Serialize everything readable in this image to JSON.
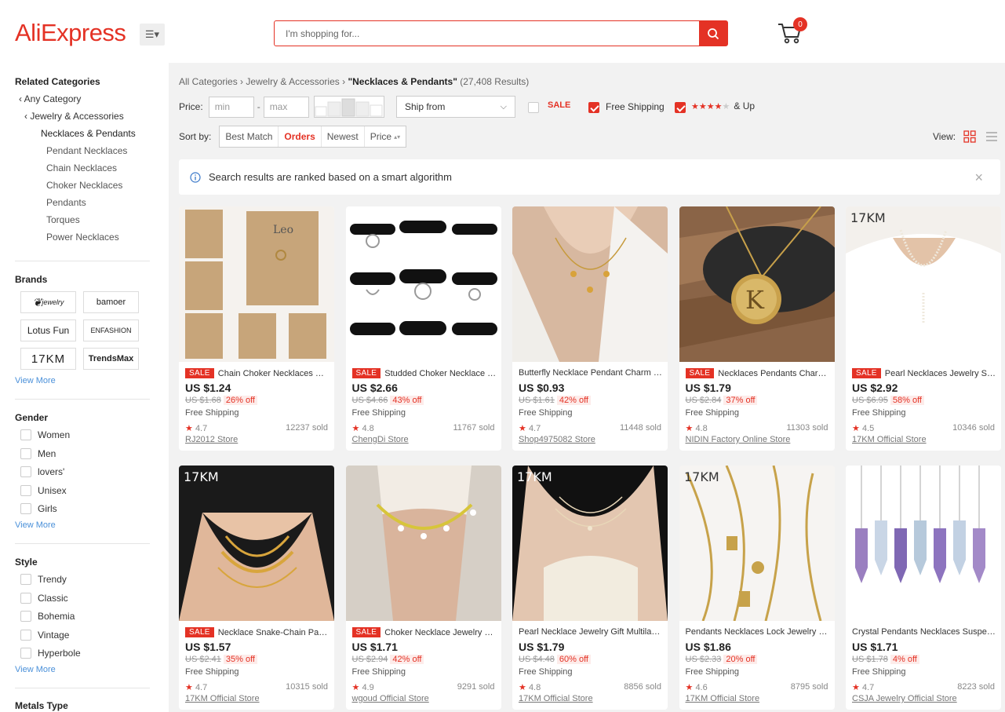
{
  "header": {
    "logo": "AliExpress",
    "menu_icon": "menu-icon",
    "search_placeholder": "I'm shopping for...",
    "cart_count": "0"
  },
  "sidebar": {
    "related_title": "Related Categories",
    "any_category": "Any Category",
    "jewelry_accessories": "Jewelry & Accessories",
    "current_category": "Necklaces & Pendants",
    "subcategories": [
      "Pendant Necklaces",
      "Chain Necklaces",
      "Choker Necklaces",
      "Pendants",
      "Torques",
      "Power Necklaces"
    ],
    "brands_title": "Brands",
    "brands": [
      "jewelry",
      "bamoer",
      "Lotus Fun",
      "ENFASHION",
      "17KM",
      "TrendsMax"
    ],
    "view_more": "View More",
    "gender_title": "Gender",
    "gender": [
      "Women",
      "Men",
      "lovers'",
      "Unisex",
      "Girls"
    ],
    "style_title": "Style",
    "style": [
      "Trendy",
      "Classic",
      "Bohemia",
      "Vintage",
      "Hyperbole"
    ],
    "metals_title": "Metals Type"
  },
  "main": {
    "breadcrumb": {
      "all": "All Categories",
      "parent": "Jewelry & Accessories",
      "current": "\"Necklaces & Pendants\"",
      "results": "(27,408 Results)"
    },
    "filters": {
      "price_label": "Price:",
      "min_placeholder": "min",
      "dash": "-",
      "max_placeholder": "max",
      "ship_from": "Ship from",
      "sale": "SALE",
      "free_shipping": "Free Shipping",
      "stars_up": "& Up"
    },
    "sort": {
      "label": "Sort by:",
      "options": [
        "Best Match",
        "Orders",
        "Newest",
        "Price"
      ],
      "active": "Orders",
      "view_label": "View:"
    },
    "notice": "Search results are ranked based on a smart algorithm"
  },
  "colors": {
    "accent": "#e43225",
    "background": "#f2f2f2"
  },
  "products": [
    {
      "sale": true,
      "title": "Chain Choker Necklaces Pendants Women",
      "price": "US $1.24",
      "orig": "US $1.68",
      "off": "26% off",
      "shipping": "Free Shipping",
      "rating": "4.7",
      "sold": "12237 sold",
      "store": "RJ2012 Store"
    },
    {
      "sale": true,
      "title": "Studded Choker Necklace Punk Leather",
      "price": "US $2.66",
      "orig": "US $4.66",
      "off": "43% off",
      "shipping": "Free Shipping",
      "rating": "4.8",
      "sold": "11767 sold",
      "store": "ChengDi Store"
    },
    {
      "sale": false,
      "title": "Butterfly Necklace Pendant Charm Jewelry",
      "price": "US $0.93",
      "orig": "US $1.61",
      "off": "42% off",
      "shipping": "Free Shipping",
      "rating": "4.7",
      "sold": "11448 sold",
      "store": "Shop4975082 Store"
    },
    {
      "sale": true,
      "title": "Necklaces Pendants Charm Letter",
      "price": "US $1.79",
      "orig": "US $2.84",
      "off": "37% off",
      "shipping": "Free Shipping",
      "rating": "4.8",
      "sold": "11303 sold",
      "store": "NIDIN Factory Online Store"
    },
    {
      "sale": true,
      "title": "Pearl Necklaces Jewelry Shell Pendant",
      "price": "US $2.92",
      "orig": "US $6.95",
      "off": "58% off",
      "shipping": "Free Shipping",
      "rating": "4.5",
      "sold": "10346 sold",
      "store": "17KM Official Store"
    },
    {
      "sale": true,
      "title": "Necklace Snake-Chain Parent Layered",
      "price": "US $1.57",
      "orig": "US $2.41",
      "off": "35% off",
      "shipping": "Free Shipping",
      "rating": "4.7",
      "sold": "10315 sold",
      "store": "17KM Official Store"
    },
    {
      "sale": true,
      "title": "Choker Necklace Jewelry Simple Beads",
      "price": "US $1.71",
      "orig": "US $2.94",
      "off": "42% off",
      "shipping": "Free Shipping",
      "rating": "4.9",
      "sold": "9291 sold",
      "store": "wgoud Official Store"
    },
    {
      "sale": false,
      "title": "Pearl Necklace Jewelry Gift Multilayer",
      "price": "US $1.79",
      "orig": "US $4.48",
      "off": "60% off",
      "shipping": "Free Shipping",
      "rating": "4.8",
      "sold": "8856 sold",
      "store": "17KM Official Store"
    },
    {
      "sale": false,
      "title": "Pendants Necklaces Lock Jewelry Gold",
      "price": "US $1.86",
      "orig": "US $2.33",
      "off": "20% off",
      "shipping": "Free Shipping",
      "rating": "4.6",
      "sold": "8795 sold",
      "store": "17KM Official Store"
    },
    {
      "sale": false,
      "title": "Crystal Pendants Necklaces Suspension",
      "price": "US $1.71",
      "orig": "US $1.78",
      "off": "4% off",
      "shipping": "Free Shipping",
      "rating": "4.7",
      "sold": "8223 sold",
      "store": "CSJA Jewelry Official Store"
    }
  ]
}
